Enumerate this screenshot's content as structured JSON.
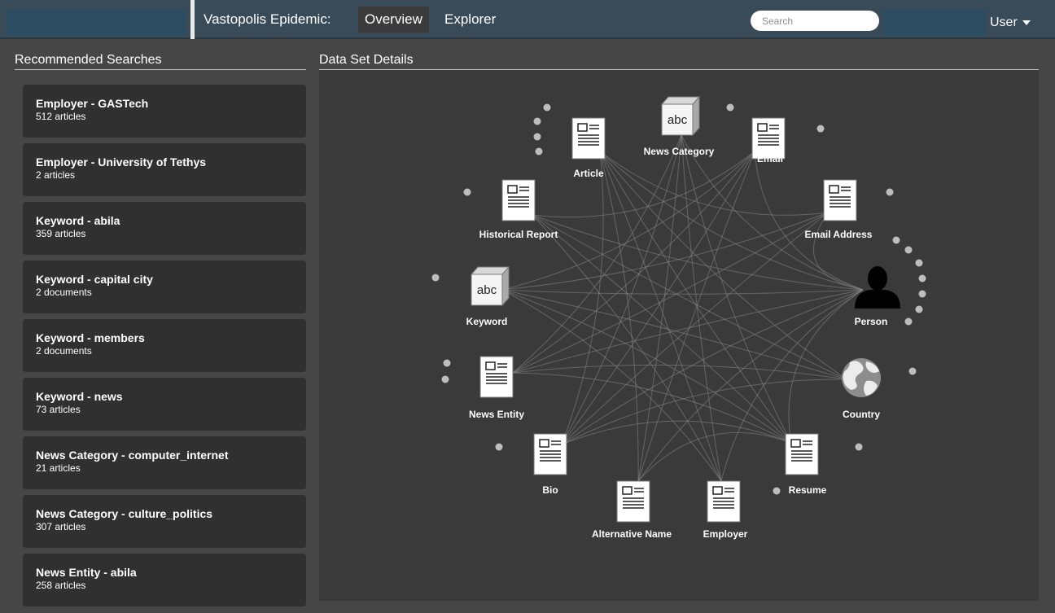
{
  "header": {
    "app_title": "Vastopolis Epidemic:",
    "tabs": [
      {
        "label": "Overview",
        "active": true
      },
      {
        "label": "Explorer",
        "active": false
      }
    ],
    "search_placeholder": "Search",
    "user_label": "User"
  },
  "sidebar": {
    "title": "Recommended Searches",
    "items": [
      {
        "title": "Employer - GASTech",
        "count": "512 articles"
      },
      {
        "title": "Employer - University of Tethys",
        "count": "2 articles"
      },
      {
        "title": "Keyword - abila",
        "count": "359 articles"
      },
      {
        "title": "Keyword - capital city",
        "count": "2 documents"
      },
      {
        "title": "Keyword - members",
        "count": "2 documents"
      },
      {
        "title": "Keyword - news",
        "count": "73 articles"
      },
      {
        "title": "News Category - computer_internet",
        "count": "21 articles"
      },
      {
        "title": "News Category - culture_politics",
        "count": "307 articles"
      },
      {
        "title": "News Entity - abila",
        "count": "258 articles"
      }
    ]
  },
  "main": {
    "title": "Data Set Details",
    "nodes": [
      {
        "id": "article",
        "label": "Article",
        "icon": "document-icon"
      },
      {
        "id": "news-category",
        "label": "News Category",
        "icon": "abc-cube-icon"
      },
      {
        "id": "email",
        "label": "Email",
        "icon": "document-icon"
      },
      {
        "id": "historical-report",
        "label": "Historical Report",
        "icon": "document-icon"
      },
      {
        "id": "email-address",
        "label": "Email Address",
        "icon": "document-icon"
      },
      {
        "id": "keyword",
        "label": "Keyword",
        "icon": "abc-cube-icon"
      },
      {
        "id": "person",
        "label": "Person",
        "icon": "person-icon"
      },
      {
        "id": "news-entity",
        "label": "News Entity",
        "icon": "document-icon"
      },
      {
        "id": "country",
        "label": "Country",
        "icon": "globe-icon"
      },
      {
        "id": "bio",
        "label": "Bio",
        "icon": "document-icon"
      },
      {
        "id": "resume",
        "label": "Resume",
        "icon": "document-icon"
      },
      {
        "id": "alternative-name",
        "label": "Alternative Name",
        "icon": "document-icon"
      },
      {
        "id": "employer",
        "label": "Employer",
        "icon": "document-icon"
      }
    ],
    "icon_glyph_text": "abc",
    "colors": {
      "panel": "#3a3a3a",
      "edges": "#8a8a8a",
      "dots": "#bdbdbd",
      "header": "#394b58"
    }
  }
}
